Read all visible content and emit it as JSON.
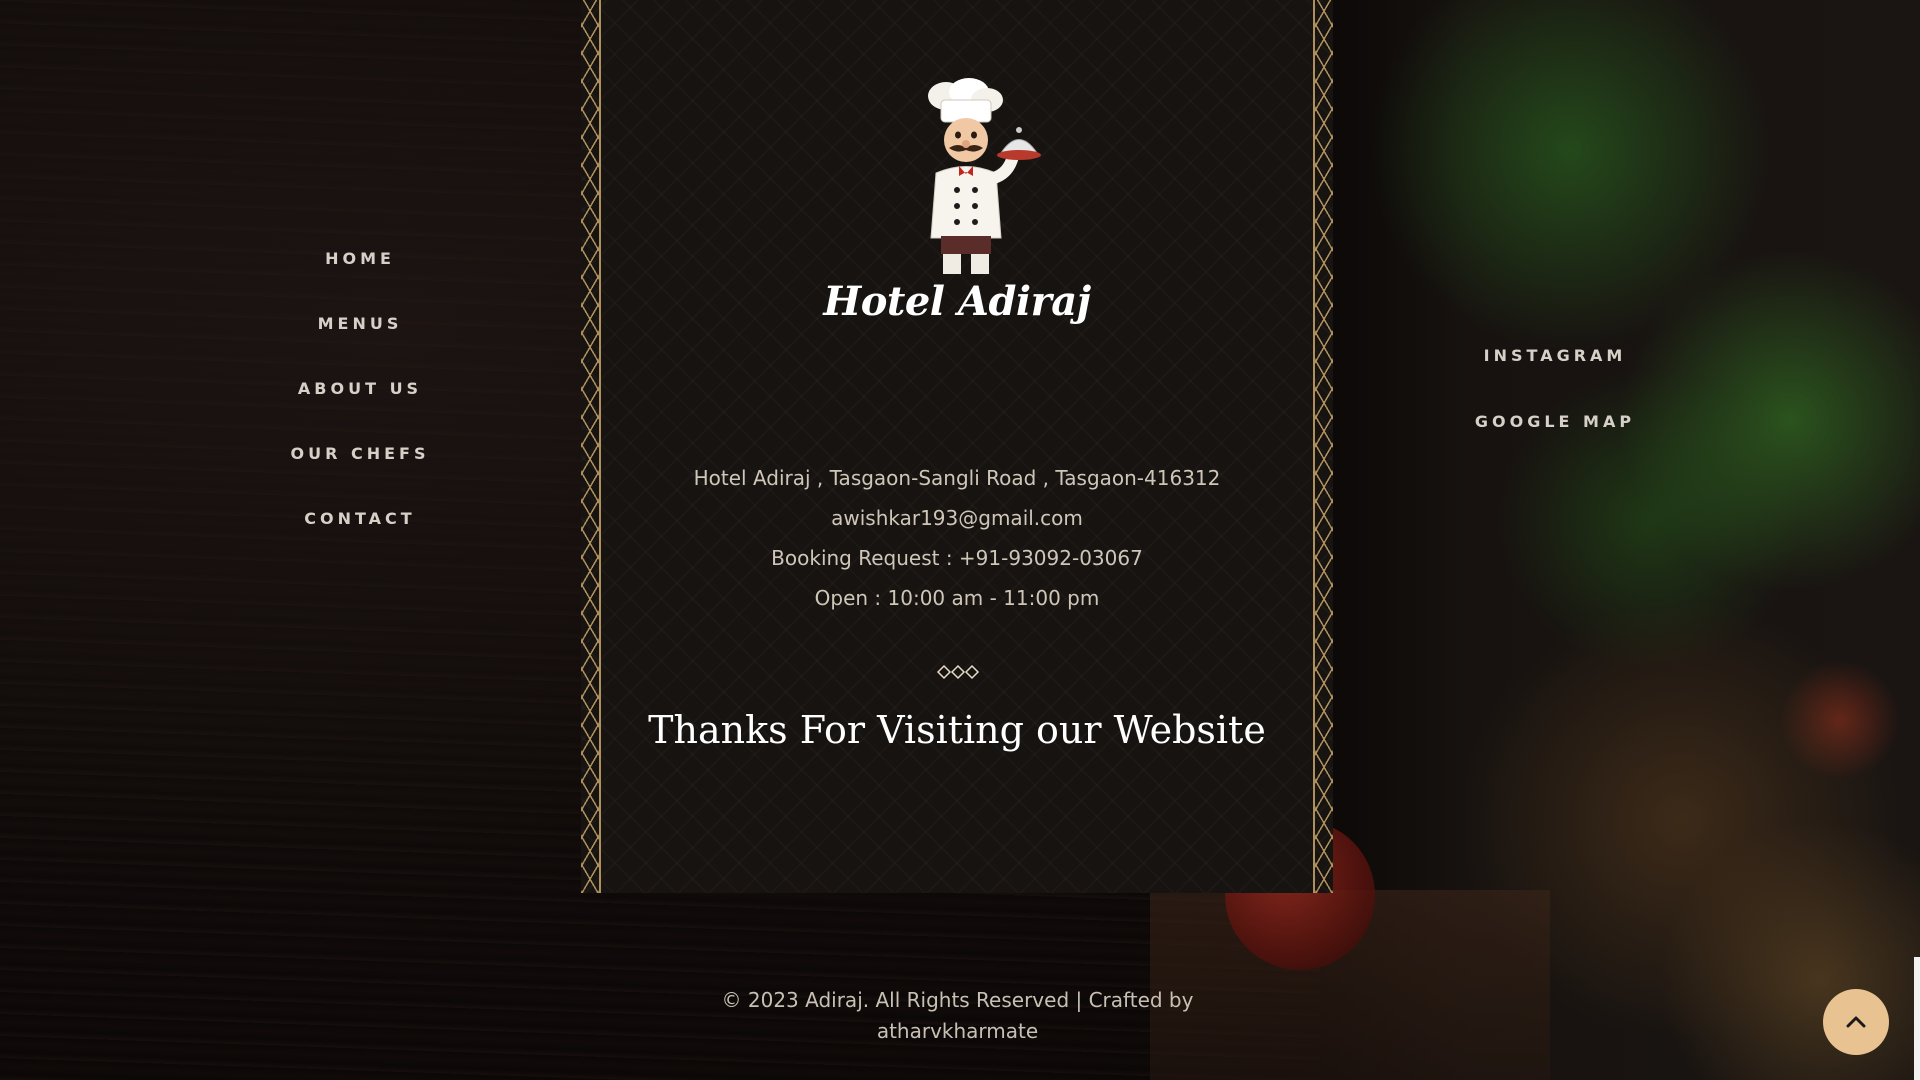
{
  "nav_left": {
    "items": [
      {
        "label": "HOME"
      },
      {
        "label": "MENUS"
      },
      {
        "label": "ABOUT US"
      },
      {
        "label": "OUR CHEFS"
      },
      {
        "label": "CONTACT"
      }
    ]
  },
  "nav_right": {
    "items": [
      {
        "label": "INSTAGRAM"
      },
      {
        "label": "GOOGLE MAP"
      }
    ]
  },
  "brand": {
    "name": "Hotel Adiraj",
    "logo_icon": "chef-icon"
  },
  "contact": {
    "address": "Hotel Adiraj , Tasgaon-Sangli Road , Tasgaon-416312",
    "email": "awishkar193@gmail.com",
    "booking": "Booking Request : +91-93092-03067",
    "hours": "Open : 10:00 am - 11:00 pm"
  },
  "thanks": "Thanks For Visiting our Website",
  "footer": {
    "copyright": "© 2023 Adiraj. All Rights Reserved | Crafted by",
    "author": "atharvkharmate"
  },
  "colors": {
    "accent_gold": "#c9a66b",
    "scroll_button": "#e8c391",
    "card_bg": "#161311"
  },
  "icons": {
    "scroll_top": "chevron-up-icon",
    "divider": "diamonds-divider-icon"
  }
}
